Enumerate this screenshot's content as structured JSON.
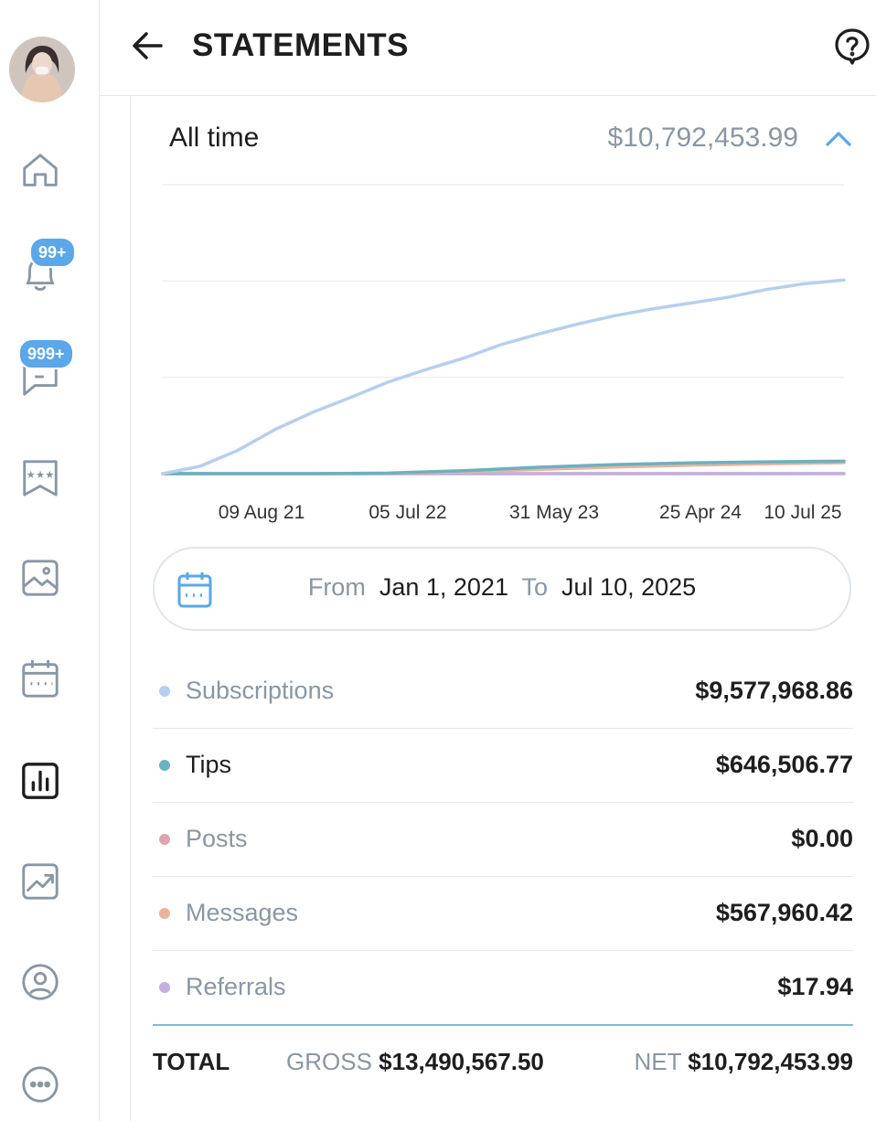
{
  "header": {
    "title": "STATEMENTS"
  },
  "sidebar": {
    "notifications_badge": "99+",
    "messages_badge": "999+",
    "badge_color": "#5aa7ea",
    "items": [
      "avatar",
      "home-icon",
      "bell-icon",
      "chat-icon",
      "bookmark-stars-icon",
      "image-icon",
      "calendar-icon",
      "statistics-icon",
      "trend-chart-icon",
      "profile-icon",
      "more-icon"
    ],
    "active_item": "statistics-icon"
  },
  "summary": {
    "period": "All time",
    "total": "$10,792,453.99"
  },
  "chart_data": {
    "type": "line",
    "x_ticks": [
      "09 Aug 21",
      "05 Jul 22",
      "31 May 23",
      "25 Apr 24",
      "10 Jul 25"
    ],
    "x_range": [
      "2021-01-01",
      "2025-07-10"
    ],
    "ylim": [
      0,
      15000000
    ],
    "grid": true,
    "series": [
      {
        "name": "Subscriptions",
        "color": "#b7cfee",
        "x": [
          "2021-01-01",
          "2021-04-01",
          "2021-07-01",
          "2021-10-01",
          "2022-01-01",
          "2022-04-01",
          "2022-07-01",
          "2022-10-01",
          "2023-01-01",
          "2023-04-01",
          "2023-07-01",
          "2023-10-01",
          "2024-01-01",
          "2024-04-01",
          "2024-07-01",
          "2024-10-01",
          "2025-01-01",
          "2025-04-01",
          "2025-07-10"
        ],
        "y": [
          0,
          380000,
          1200000,
          2300000,
          3200000,
          3950000,
          4750000,
          5400000,
          6000000,
          6700000,
          7250000,
          7750000,
          8200000,
          8550000,
          8850000,
          9150000,
          9550000,
          9850000,
          10050000
        ]
      },
      {
        "name": "Tips",
        "color": "#6ab1c1",
        "x": [
          "2021-01-01",
          "2022-01-01",
          "2022-07-01",
          "2023-01-01",
          "2023-07-01",
          "2024-01-01",
          "2024-07-01",
          "2025-01-01",
          "2025-07-10"
        ],
        "y": [
          0,
          0,
          30000,
          150000,
          330000,
          470000,
          560000,
          610000,
          646506.77
        ]
      },
      {
        "name": "Posts",
        "color": "#e0a3b2",
        "x": [
          "2021-01-01",
          "2025-07-10"
        ],
        "y": [
          0,
          0
        ]
      },
      {
        "name": "Messages",
        "color": "#ecb39c",
        "x": [
          "2021-01-01",
          "2022-01-01",
          "2022-07-01",
          "2023-01-01",
          "2023-07-01",
          "2024-01-01",
          "2024-07-01",
          "2025-01-01",
          "2025-07-10"
        ],
        "y": [
          0,
          0,
          15000,
          100000,
          220000,
          340000,
          440000,
          510000,
          567960.42
        ]
      },
      {
        "name": "Referrals",
        "color": "#c2b0de",
        "x": [
          "2021-01-01",
          "2025-07-10"
        ],
        "y": [
          0,
          17.94
        ]
      }
    ]
  },
  "date_range": {
    "from_label": "From",
    "from": "Jan 1, 2021",
    "to_label": "To",
    "to": "Jul 10, 2025"
  },
  "breakdown": [
    {
      "label": "Subscriptions",
      "value": "$9,577,968.86",
      "color": "#b7cfee",
      "active": false
    },
    {
      "label": "Tips",
      "value": "$646,506.77",
      "color": "#6ab1c1",
      "active": true
    },
    {
      "label": "Posts",
      "value": "$0.00",
      "color": "#e0a3b2",
      "active": false
    },
    {
      "label": "Messages",
      "value": "$567,960.42",
      "color": "#ecb39c",
      "active": false
    },
    {
      "label": "Referrals",
      "value": "$17.94",
      "color": "#c2b0de",
      "active": false
    }
  ],
  "totals": {
    "label": "TOTAL",
    "gross_label": "GROSS",
    "gross": "$13,490,567.50",
    "net_label": "NET",
    "net": "$10,792,453.99"
  }
}
